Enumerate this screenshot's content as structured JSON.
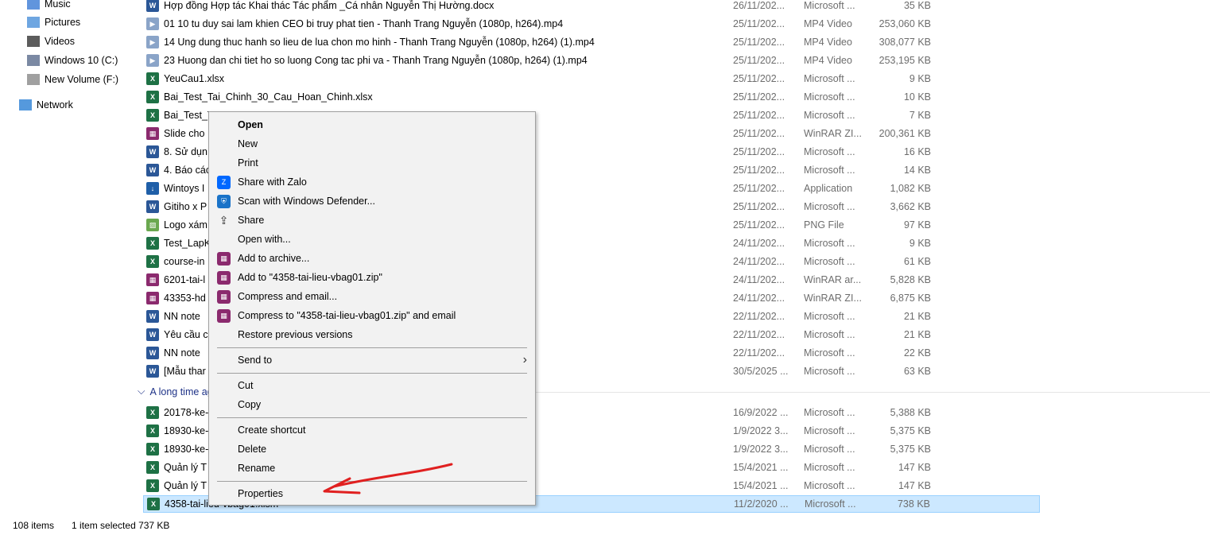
{
  "sidebar": {
    "items": [
      {
        "label": "Music",
        "icon": "music-icon"
      },
      {
        "label": "Pictures",
        "icon": "pictures-icon"
      },
      {
        "label": "Videos",
        "icon": "videos-icon"
      },
      {
        "label": "Windows 10 (C:)",
        "icon": "drive-icon"
      },
      {
        "label": "New Volume (F:)",
        "icon": "drive-icon"
      },
      {
        "label": "Network",
        "icon": "network-icon"
      }
    ]
  },
  "files": [
    {
      "name": "Hợp đồng Hợp tác Khai thác Tác phẩm _Cá nhân Nguyễn Thị Hường.docx",
      "date": "26/11/202...",
      "type": "Microsoft ...",
      "size": "35 KB",
      "icon": "word"
    },
    {
      "name": "01  10 tu duy sai lam khien CEO bi truy phat tien - Thanh Trang Nguyễn (1080p, h264).mp4",
      "date": "25/11/202...",
      "type": "MP4 Video",
      "size": "253,060 KB",
      "icon": "video"
    },
    {
      "name": "14  Ung dung thuc hanh so lieu de lua chon mo hinh - Thanh Trang Nguyễn (1080p, h264) (1).mp4",
      "date": "25/11/202...",
      "type": "MP4 Video",
      "size": "308,077 KB",
      "icon": "video"
    },
    {
      "name": "23  Huong dan chi tiet ho so luong Cong tac phi va - Thanh Trang Nguyễn (1080p, h264) (1).mp4",
      "date": "25/11/202...",
      "type": "MP4 Video",
      "size": "253,195 KB",
      "icon": "video"
    },
    {
      "name": "YeuCau1.xlsx",
      "date": "25/11/202...",
      "type": "Microsoft ...",
      "size": "9 KB",
      "icon": "excel"
    },
    {
      "name": "Bai_Test_Tai_Chinh_30_Cau_Hoan_Chinh.xlsx",
      "date": "25/11/202...",
      "type": "Microsoft ...",
      "size": "10 KB",
      "icon": "excel"
    },
    {
      "name": "Bai_Test_T",
      "date": "25/11/202...",
      "type": "Microsoft ...",
      "size": "7 KB",
      "icon": "excel"
    },
    {
      "name": "Slide cho",
      "date": "25/11/202...",
      "type": "WinRAR ZI...",
      "size": "200,361 KB",
      "icon": "rar"
    },
    {
      "name": "8. Sử dụn",
      "date": "25/11/202...",
      "type": "Microsoft ...",
      "size": "16 KB",
      "icon": "word"
    },
    {
      "name": "4. Báo các",
      "date": "25/11/202...",
      "type": "Microsoft ...",
      "size": "14 KB",
      "icon": "word"
    },
    {
      "name": "Wintoys I",
      "date": "25/11/202...",
      "type": "Application",
      "size": "1,082 KB",
      "icon": "app"
    },
    {
      "name": "Gitiho x P",
      "date": "25/11/202...",
      "type": "Microsoft ...",
      "size": "3,662 KB",
      "icon": "word"
    },
    {
      "name": "Logo xám",
      "date": "25/11/202...",
      "type": "PNG File",
      "size": "97 KB",
      "icon": "image"
    },
    {
      "name": "Test_LapK",
      "date": "24/11/202...",
      "type": "Microsoft ...",
      "size": "9 KB",
      "icon": "excel"
    },
    {
      "name": "course-in",
      "date": "24/11/202...",
      "type": "Microsoft ...",
      "size": "61 KB",
      "icon": "excel"
    },
    {
      "name": "6201-tai-l",
      "date": "24/11/202...",
      "type": "WinRAR ar...",
      "size": "5,828 KB",
      "icon": "rar"
    },
    {
      "name": "43353-hd",
      "date": "24/11/202...",
      "type": "WinRAR ZI...",
      "size": "6,875 KB",
      "icon": "rar"
    },
    {
      "name": "NN note",
      "date": "22/11/202...",
      "type": "Microsoft ...",
      "size": "21 KB",
      "icon": "word"
    },
    {
      "name": "Yêu cầu c",
      "date": "22/11/202...",
      "type": "Microsoft ...",
      "size": "21 KB",
      "icon": "word"
    },
    {
      "name": "NN note",
      "date": "22/11/202...",
      "type": "Microsoft ...",
      "size": "22 KB",
      "icon": "word"
    },
    {
      "name": "[Mẫu thar",
      "date": "30/5/2025 ...",
      "type": "Microsoft ...",
      "size": "63 KB",
      "icon": "word"
    }
  ],
  "group_label": "A long time ago",
  "old_files": [
    {
      "name": "20178-ke-",
      "date": "16/9/2022 ...",
      "type": "Microsoft ...",
      "size": "5,388 KB",
      "icon": "excel"
    },
    {
      "name": "18930-ke-",
      "date": "1/9/2022 3...",
      "type": "Microsoft ...",
      "size": "5,375 KB",
      "icon": "excel"
    },
    {
      "name": "18930-ke-",
      "date": "1/9/2022 3...",
      "type": "Microsoft ...",
      "size": "5,375 KB",
      "icon": "excel"
    },
    {
      "name": "Quản lý T",
      "date": "15/4/2021 ...",
      "type": "Microsoft ...",
      "size": "147 KB",
      "icon": "excel"
    },
    {
      "name": "Quản lý T",
      "date": "15/4/2021 ...",
      "type": "Microsoft ...",
      "size": "147 KB",
      "icon": "excel"
    },
    {
      "name": "4358-tai-lieu-vbag01.xlsm",
      "date": "11/2/2020 ...",
      "type": "Microsoft ...",
      "size": "738 KB",
      "icon": "excel",
      "selected": true
    }
  ],
  "status": {
    "count": "108 items",
    "selected": "1 item selected  737 KB"
  },
  "context_menu": {
    "items": [
      {
        "label": "Open",
        "bold": true
      },
      {
        "label": "New"
      },
      {
        "label": "Print"
      },
      {
        "label": "Share with Zalo",
        "icon": "zalo"
      },
      {
        "label": "Scan with Windows Defender...",
        "icon": "defender"
      },
      {
        "label": "Share",
        "icon": "share"
      },
      {
        "label": "Open with..."
      },
      {
        "label": "Add to archive...",
        "icon": "rar"
      },
      {
        "label": "Add to \"4358-tai-lieu-vbag01.zip\"",
        "icon": "rar"
      },
      {
        "label": "Compress and email...",
        "icon": "rar"
      },
      {
        "label": "Compress to \"4358-tai-lieu-vbag01.zip\" and email",
        "icon": "rar"
      },
      {
        "label": "Restore previous versions"
      },
      {
        "sep": true
      },
      {
        "label": "Send to",
        "submenu": true
      },
      {
        "sep": true
      },
      {
        "label": "Cut"
      },
      {
        "label": "Copy"
      },
      {
        "sep": true
      },
      {
        "label": "Create shortcut"
      },
      {
        "label": "Delete"
      },
      {
        "label": "Rename"
      },
      {
        "sep": true
      },
      {
        "label": "Properties"
      }
    ]
  },
  "colors": {
    "selection": "#cce8ff",
    "annotation": "#e02020",
    "word": "#2b5797",
    "excel": "#1e7145"
  }
}
